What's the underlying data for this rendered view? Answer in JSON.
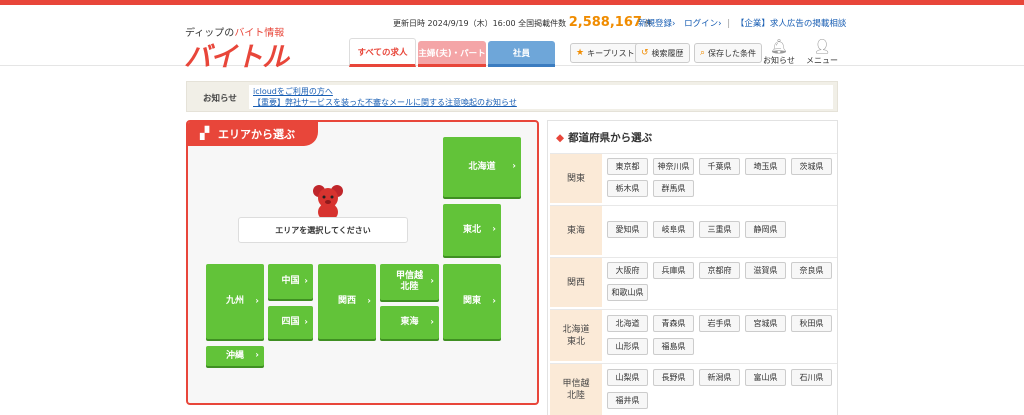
{
  "brand": {
    "tagline_prefix": "ディップの",
    "tagline_accent": "バイト情報",
    "name": "バイトル",
    "color": "#e8463a"
  },
  "stats": {
    "updated_label": "更新日時",
    "updated_value": "2024/9/19（木）16:00",
    "total_label": "全国掲載件数",
    "total_value": "2,588,167",
    "unit": "件"
  },
  "toplinks": {
    "register": "新規登録",
    "login": "ログイン",
    "corporate": "【企業】求人広告の掲載相談"
  },
  "tabs": {
    "all": "すべての求人",
    "part": "主婦(夫)・パート",
    "employee": "社員"
  },
  "header_buttons": {
    "keeplist": "キープリスト",
    "history": "検索履歴",
    "saved": "保存した条件",
    "notify": "お知らせ",
    "menu": "メニュー"
  },
  "notice": {
    "label": "お知らせ",
    "items": [
      "icloudをご利用の方へ",
      "【重要】弊社サービスを装った不審なメールに関する注意喚起のお知らせ"
    ]
  },
  "area": {
    "title": "エリアから選ぶ",
    "prompt": "エリアを選択してください",
    "regions": {
      "hokkaido": "北海道",
      "tohoku": "東北",
      "kyushu": "九州",
      "chugoku": "中国",
      "shikoku": "四国",
      "kansai": "関西",
      "koshinetsu": "甲信越\n北陸",
      "tokai": "東海",
      "kanto": "関東",
      "okinawa": "沖縄"
    }
  },
  "prefectures": {
    "title": "都道府県から選ぶ",
    "groups": [
      {
        "label": "関東",
        "items": [
          "東京都",
          "神奈川県",
          "千葉県",
          "埼玉県",
          "茨城県",
          "栃木県",
          "群馬県"
        ]
      },
      {
        "label": "東海",
        "items": [
          "愛知県",
          "岐阜県",
          "三重県",
          "静岡県"
        ]
      },
      {
        "label": "関西",
        "items": [
          "大阪府",
          "兵庫県",
          "京都府",
          "滋賀県",
          "奈良県",
          "和歌山県"
        ]
      },
      {
        "label": "北海道\n東北",
        "items": [
          "北海道",
          "青森県",
          "岩手県",
          "宮城県",
          "秋田県",
          "山形県",
          "福島県"
        ]
      },
      {
        "label": "甲信越\n北陸",
        "items": [
          "山梨県",
          "長野県",
          "新潟県",
          "富山県",
          "石川県",
          "福井県"
        ]
      }
    ]
  }
}
